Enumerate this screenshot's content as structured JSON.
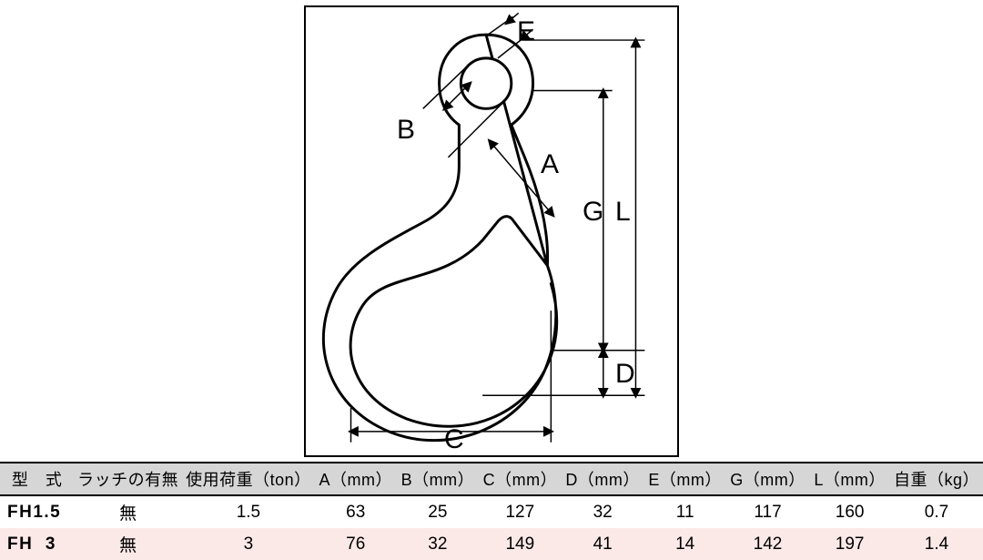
{
  "diagram": {
    "labels": {
      "A": "A",
      "B": "B",
      "C": "C",
      "D": "D",
      "E": "E",
      "G": "G",
      "L": "L"
    }
  },
  "table": {
    "headers": {
      "model": "型　式",
      "latch": "ラッチの有無",
      "wll": "使用荷重（ton）",
      "A": "A（mm）",
      "B": "B（mm）",
      "C": "C（mm）",
      "D": "D（mm）",
      "E": "E（mm）",
      "G": "G（mm）",
      "L": "L（mm）",
      "weight": "自重（kg）"
    },
    "rows": [
      {
        "model": "FH1.5",
        "latch": "無",
        "wll": "1.5",
        "A": "63",
        "B": "25",
        "C": "127",
        "D": "32",
        "E": "11",
        "G": "117",
        "L": "160",
        "weight": "0.7"
      },
      {
        "model": "FH  3",
        "latch": "無",
        "wll": "3",
        "A": "76",
        "B": "32",
        "C": "149",
        "D": "41",
        "E": "14",
        "G": "142",
        "L": "197",
        "weight": "1.4"
      }
    ]
  },
  "chart_data": {
    "type": "table",
    "title": "Hook dimension specifications",
    "columns": [
      "型式",
      "ラッチの有無",
      "使用荷重(ton)",
      "A(mm)",
      "B(mm)",
      "C(mm)",
      "D(mm)",
      "E(mm)",
      "G(mm)",
      "L(mm)",
      "自重(kg)"
    ],
    "rows": [
      [
        "FH1.5",
        "無",
        1.5,
        63,
        25,
        127,
        32,
        11,
        117,
        160,
        0.7
      ],
      [
        "FH 3",
        "無",
        3,
        76,
        32,
        149,
        41,
        14,
        142,
        197,
        1.4
      ]
    ]
  }
}
